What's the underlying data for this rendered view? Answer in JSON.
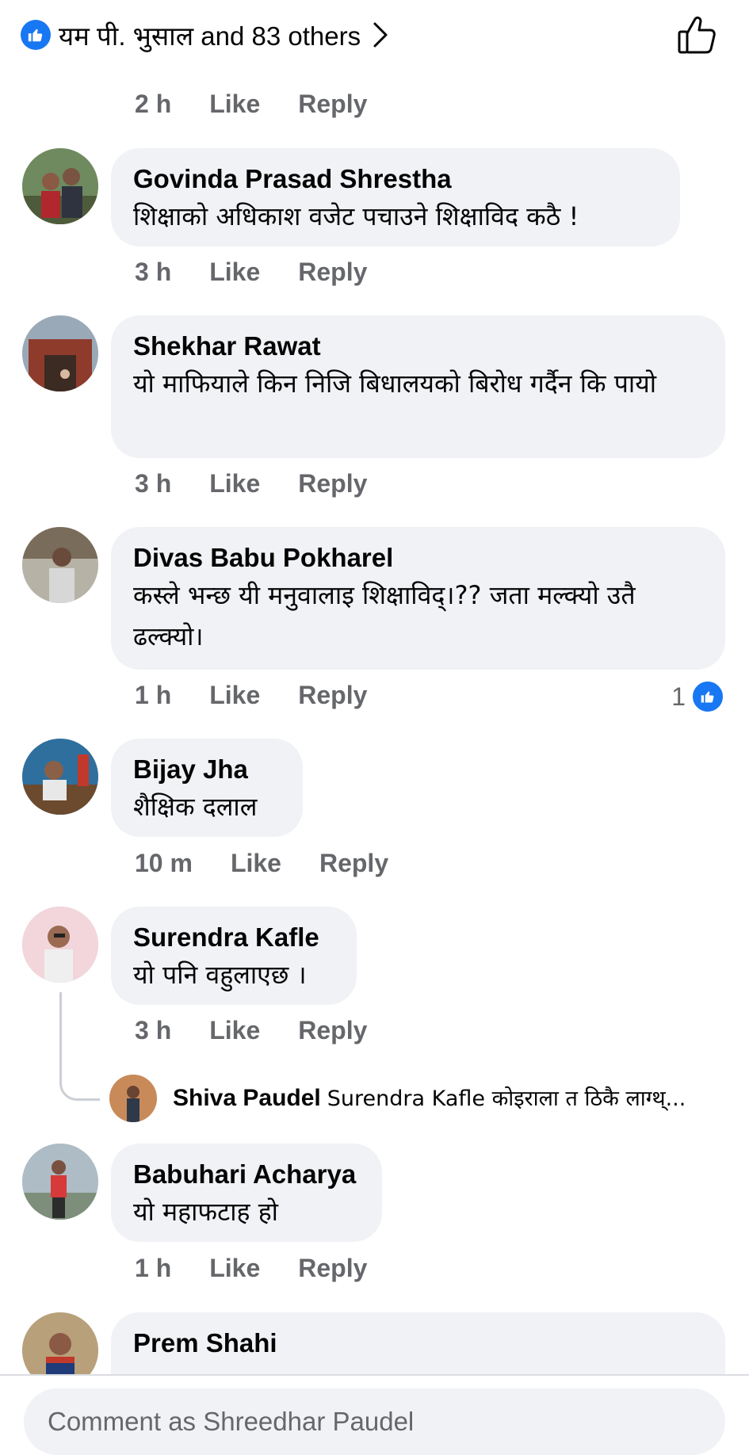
{
  "reactions": {
    "text": "यम पी. भुसाल and 83 others"
  },
  "first_meta": {
    "time": "2 h",
    "like": "Like",
    "reply": "Reply"
  },
  "comments": [
    {
      "author": "Govinda Prasad Shrestha",
      "text": "शिक्षाको अधिकाश वजेट पचाउने शिक्षाविद  कठै !",
      "time": "3 h",
      "like": "Like",
      "reply": "Reply"
    },
    {
      "author": "Shekhar Rawat",
      "text": "यो माफियाले किन निजि बिधालयको बिरोध गर्दैन कि पायो",
      "time": "3 h",
      "like": "Like",
      "reply": "Reply"
    },
    {
      "author": "Divas Babu Pokharel",
      "text": "कस्ले भन्छ यी मनुवालाइ शिक्षाविद्।?? जता मल्क्यो उतै ढल्क्यो।",
      "time": "1 h",
      "like": "Like",
      "reply": "Reply",
      "reaction_count": "1"
    },
    {
      "author": "Bijay Jha",
      "text": "शैक्षिक दलाल",
      "time": "10 m",
      "like": "Like",
      "reply": "Reply"
    },
    {
      "author": "Surendra Kafle",
      "text": "यो पनि वहुलाएछ ।",
      "time": "3 h",
      "like": "Like",
      "reply": "Reply"
    },
    {
      "author": "Babuhari Acharya",
      "text": "यो महाफटाह हो",
      "time": "1 h",
      "like": "Like",
      "reply": "Reply"
    },
    {
      "author": "Prem Shahi"
    }
  ],
  "reply_preview": {
    "author": "Shiva Paudel",
    "text": "Surendra Kafle कोइराला त ठिकै लाग्थ्..."
  },
  "composer": {
    "placeholder": "Comment as Shreedhar Paudel"
  },
  "colors": {
    "like_blue": "#1877f2",
    "bubble": "#f0f2f5",
    "meta_grey": "#65676b"
  }
}
